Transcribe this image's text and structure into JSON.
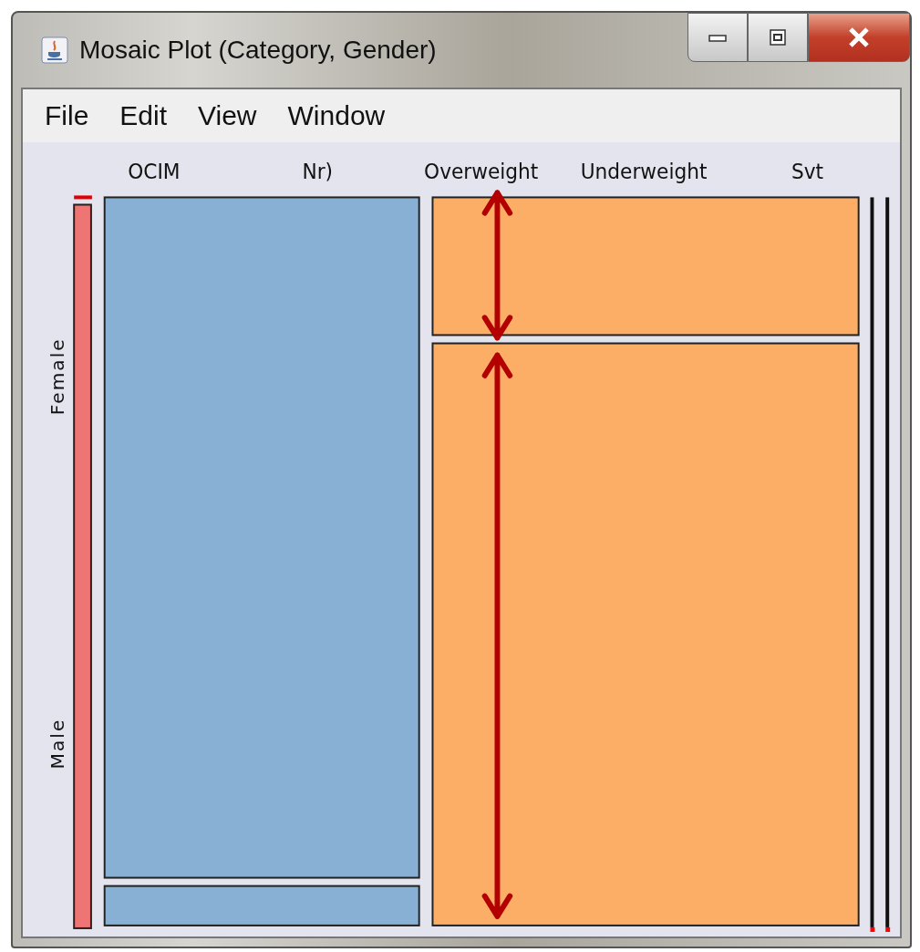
{
  "window": {
    "title": "Mosaic Plot (Category, Gender)"
  },
  "menu": [
    "File",
    "Edit",
    "View",
    "Window"
  ],
  "plot": {
    "column_labels": [
      "OCIM",
      "Nr)",
      "Overweight",
      "Underweight",
      "Svt"
    ],
    "row_labels": [
      "Female",
      "Male"
    ],
    "columns": [
      {
        "color": "#87b0d4"
      },
      {
        "color": "#fdae66"
      }
    ]
  }
}
